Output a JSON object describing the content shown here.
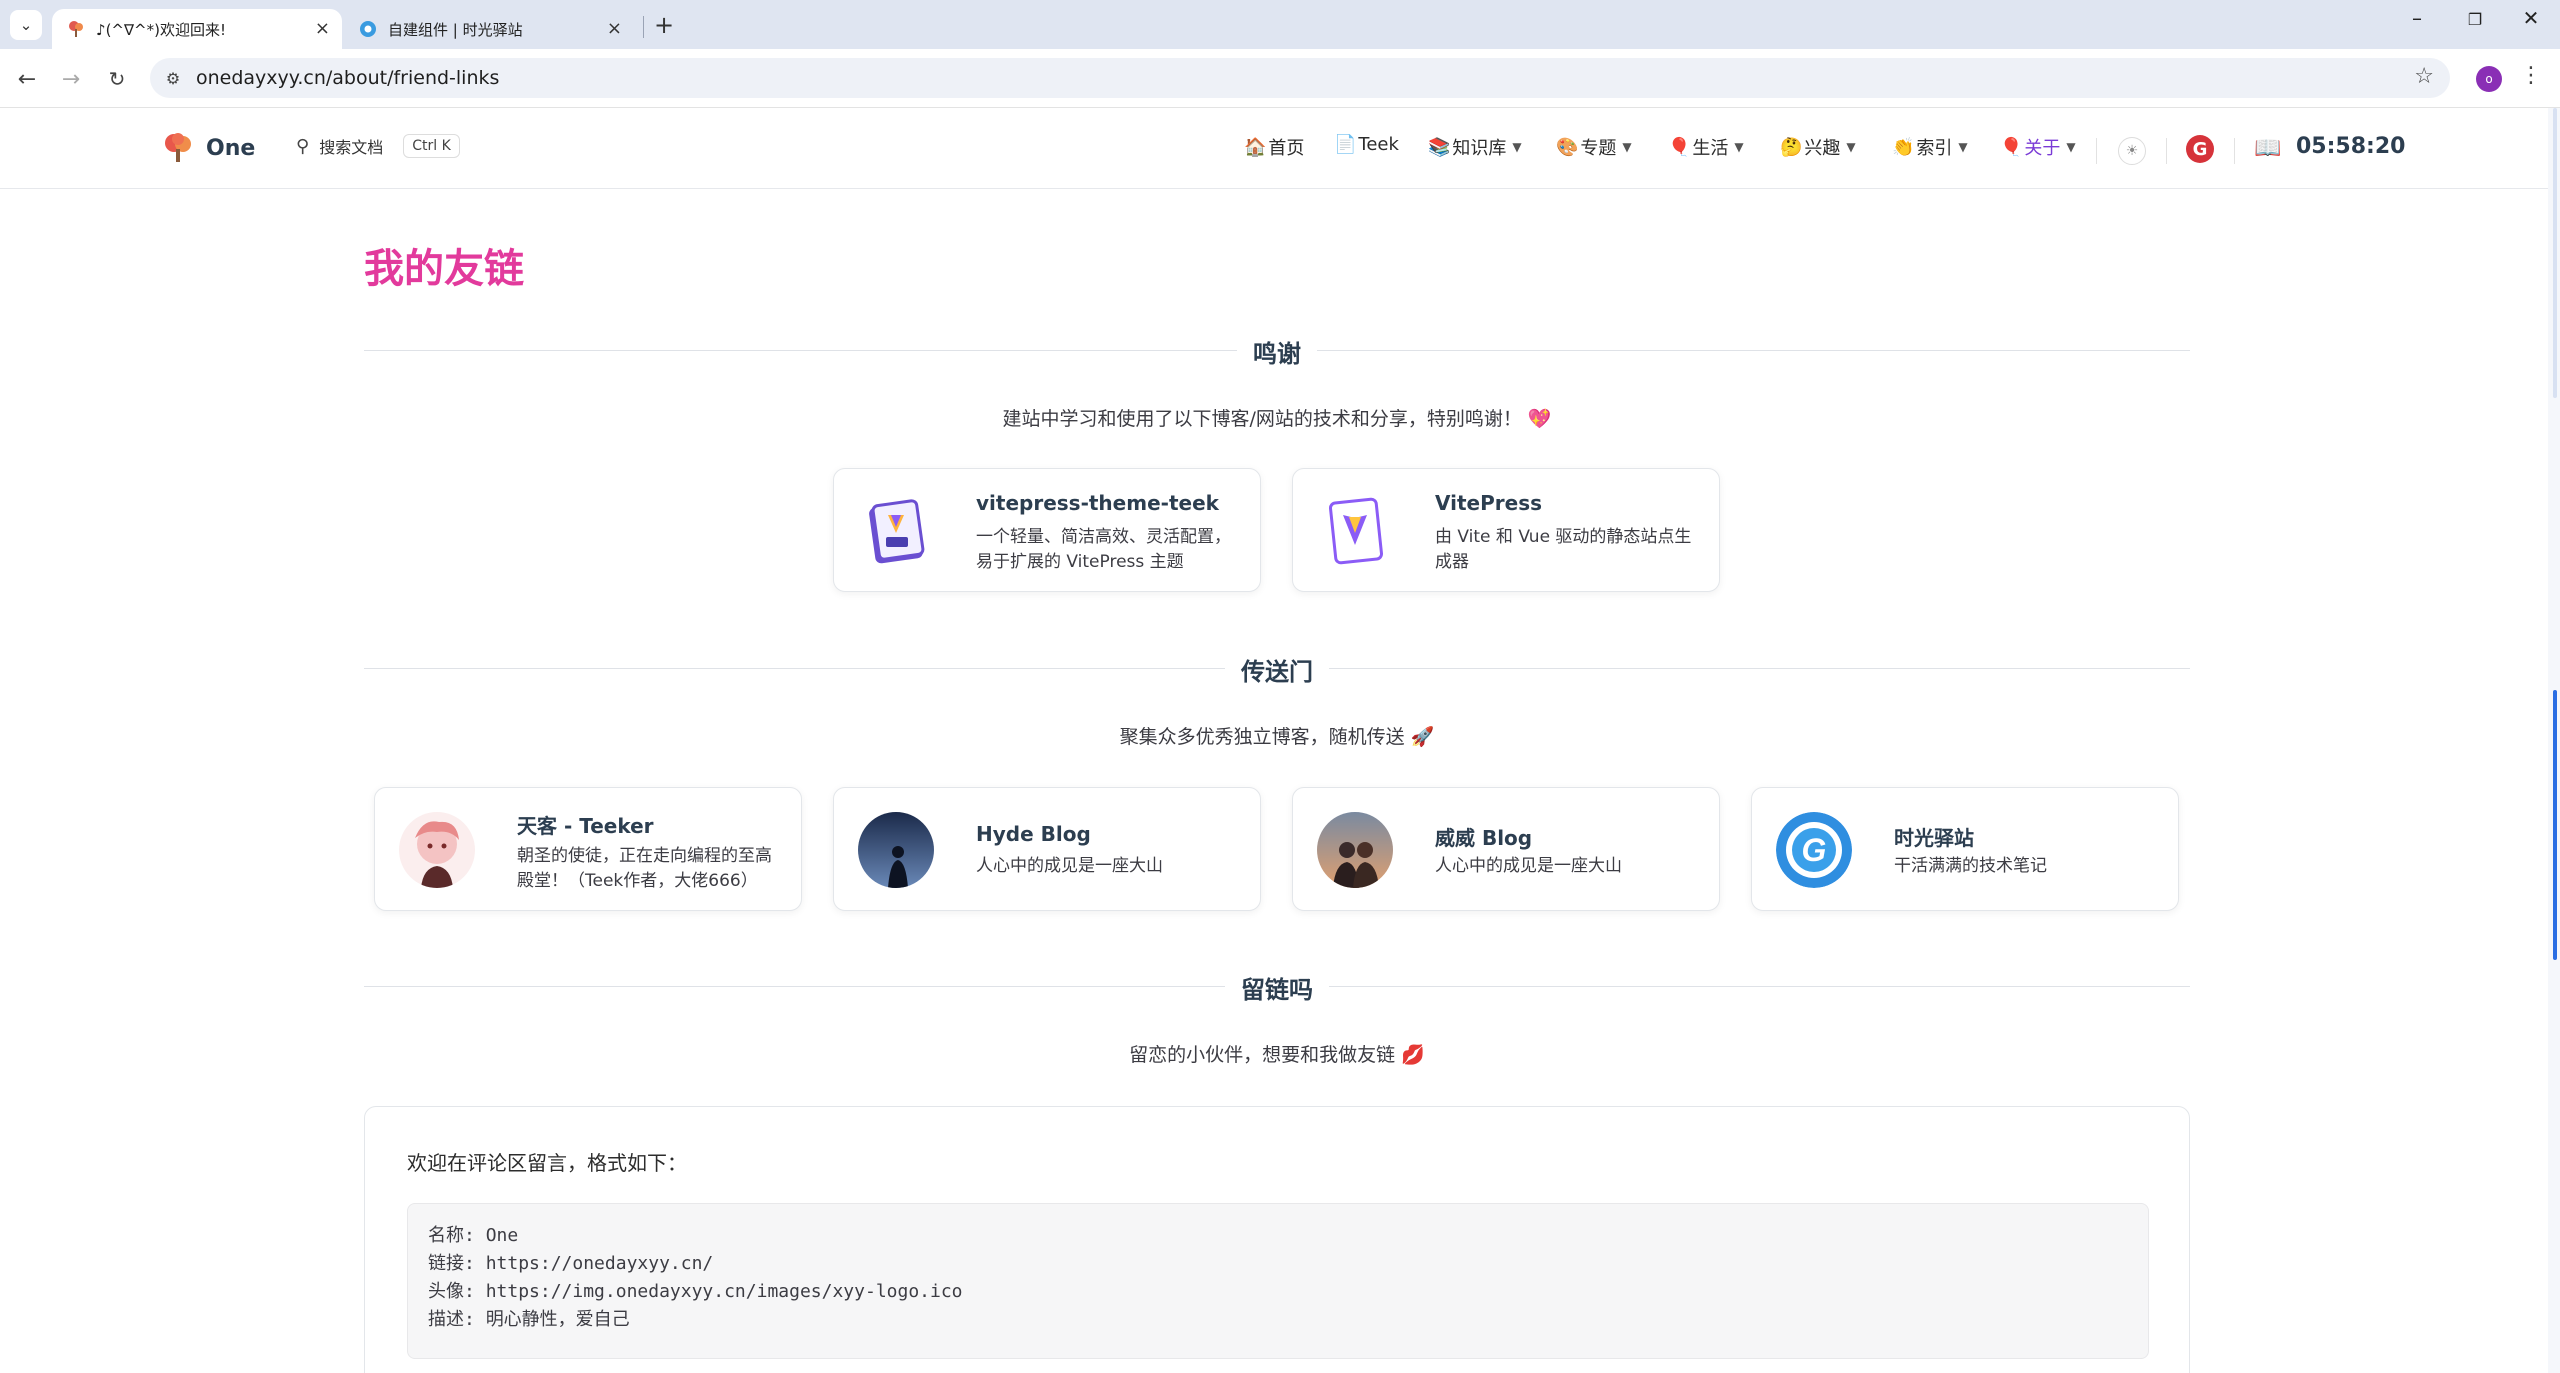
{
  "browser": {
    "tabs": [
      {
        "title": "♪(^∇^*)欢迎回来!",
        "active": true
      },
      {
        "title": "自建组件 | 时光驿站",
        "active": false
      }
    ],
    "url": "onedayxyy.cn/about/friend-links",
    "profile_initial": "o"
  },
  "nav": {
    "logo_text": "One",
    "search_label": "搜索文档",
    "search_kbd": "Ctrl K",
    "menu": [
      {
        "emoji": "🏠",
        "label": "首页",
        "dropdown": false
      },
      {
        "emoji": "📄",
        "label": "Teek",
        "dropdown": false
      },
      {
        "emoji": "📚",
        "label": "知识库",
        "dropdown": true
      },
      {
        "emoji": "🎨",
        "label": "专题",
        "dropdown": true
      },
      {
        "emoji": "🎈",
        "label": "生活",
        "dropdown": true
      },
      {
        "emoji": "🤔",
        "label": "兴趣",
        "dropdown": true
      },
      {
        "emoji": "👏",
        "label": "索引",
        "dropdown": true
      },
      {
        "emoji": "🎈",
        "label": "关于",
        "dropdown": true,
        "active": true
      }
    ],
    "clock": "05:58:20"
  },
  "page": {
    "title": "我的友链",
    "sections": [
      {
        "heading": "鸣谢",
        "desc": "建站中学习和使用了以下博客/网站的技术和分享，特别鸣谢！",
        "desc_emoji": "💖",
        "cards": [
          {
            "name": "vitepress-theme-teek",
            "desc": "一个轻量、简洁高效、灵活配置，易于扩展的 VitePress 主题"
          },
          {
            "name": "VitePress",
            "desc": "由 Vite 和 Vue 驱动的静态站点生成器"
          }
        ]
      },
      {
        "heading": "传送门",
        "desc": "聚集众多优秀独立博客，随机传送",
        "desc_emoji": "🚀",
        "cards": [
          {
            "name": "天客 - Teeker",
            "desc": "朝圣的使徒，正在走向编程的至高殿堂！（Teek作者，大佬666）"
          },
          {
            "name": "Hyde Blog",
            "desc": "人心中的成见是一座大山"
          },
          {
            "name": "威威 Blog",
            "desc": "人心中的成见是一座大山"
          },
          {
            "name": "时光驿站",
            "desc": "干活满满的技术笔记"
          }
        ]
      },
      {
        "heading": "留链吗",
        "desc": "留恋的小伙伴，想要和我做友链",
        "desc_emoji": "💋"
      }
    ],
    "comment": {
      "intro": "欢迎在评论区留言，格式如下：",
      "lines": [
        {
          "key": "名称: ",
          "value": "One"
        },
        {
          "key": "链接: ",
          "value": "https://onedayxyy.cn/"
        },
        {
          "key": "头像: ",
          "value": "https://img.onedayxyy.cn/images/xyy-logo.ico"
        },
        {
          "key": "描述: ",
          "value": "明心静性，爱自己"
        }
      ]
    }
  }
}
